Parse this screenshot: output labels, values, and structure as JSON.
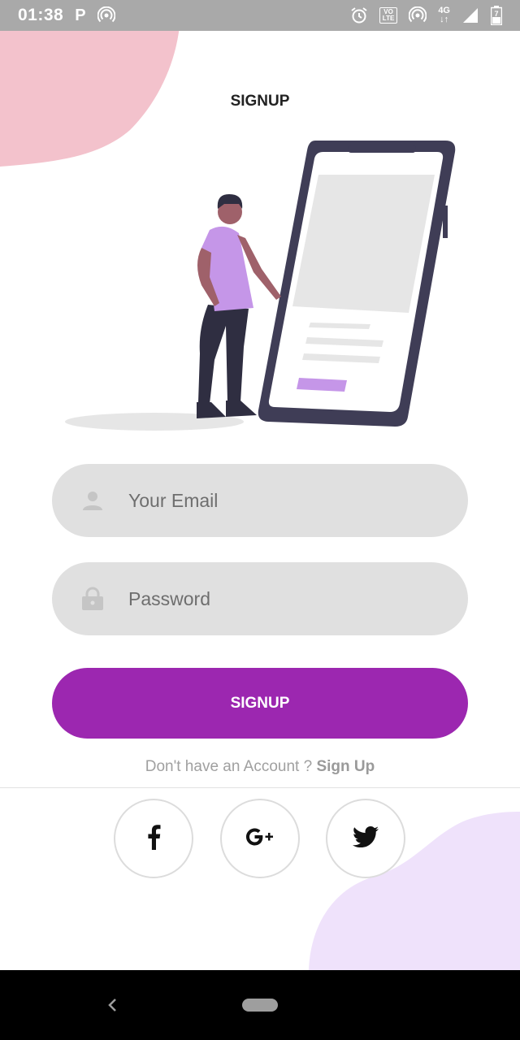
{
  "status_bar": {
    "time": "01:38",
    "p_label": "P",
    "lte_top": "VO",
    "lte_bottom": "LTE",
    "network_label": "4G",
    "battery_level": "7"
  },
  "header": {
    "title": "SIGNUP"
  },
  "form": {
    "email": {
      "placeholder": "Your Email",
      "value": "",
      "icon": "person-icon"
    },
    "password": {
      "placeholder": "Password",
      "value": "",
      "icon": "lock-icon"
    },
    "submit_label": "SIGNUP"
  },
  "account": {
    "question": "Don't have an Account ? ",
    "link": "Sign Up"
  },
  "social": [
    {
      "name": "facebook",
      "icon": "facebook-icon"
    },
    {
      "name": "google-plus",
      "icon": "google-plus-icon"
    },
    {
      "name": "twitter",
      "icon": "twitter-icon"
    }
  ],
  "colors": {
    "accent": "#9c27b0",
    "field_bg": "#e0e0e0",
    "blob_top": "#f3c2cc",
    "blob_bottom": "#efe2fb",
    "illustration_purple": "#c596e8",
    "phone_frame": "#3f3d56"
  }
}
